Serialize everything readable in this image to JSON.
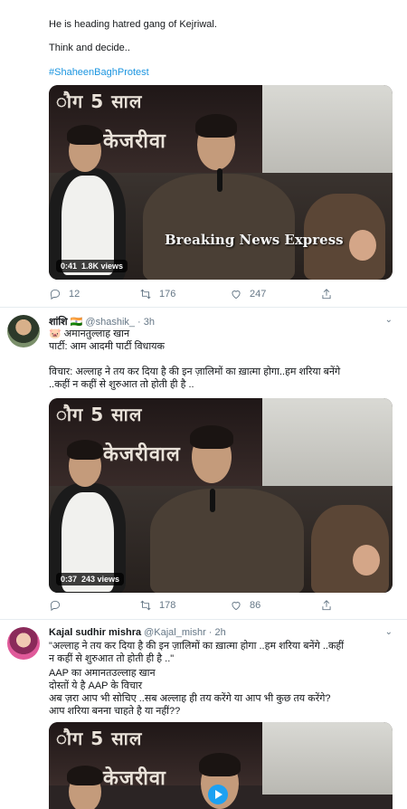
{
  "tweet1": {
    "lines": [
      "He is heading hatred gang of Kejriwal.",
      "Think and decide..",
      "#ShaheenBaghProtest"
    ],
    "video": {
      "banner_line1": "ौग 5 साल",
      "banner_line2": "केजरीवा",
      "watermark": "Breaking News Express",
      "duration": "0:41",
      "views": "1.8K views"
    },
    "actions": {
      "replies": "12",
      "retweets": "176",
      "likes": "247"
    }
  },
  "tweet2": {
    "name": "शांशि 🇮🇳",
    "handle": "@shashik_ · 3h",
    "lines": [
      "🐷 अमानतुल्लाह खान",
      "पार्टी: आम आदमी पार्टी विधायक",
      "",
      "विचार: अल्लाह ने तय कर दिया है की इन ज़ालिमों का ख़ात्मा होगा..हम शरिया बनेंगे",
      "..कहीं न कहीं से शुरुआत तो होती ही है .."
    ],
    "video": {
      "banner_line1": "ौग 5 साल",
      "banner_line2": "केजरीवाल",
      "duration": "0:37",
      "views": "243 views"
    },
    "actions": {
      "retweets": "178",
      "likes": "86"
    }
  },
  "tweet3": {
    "name": "Kajal sudhir mishra",
    "handle": "@Kajal_mishr · 2h",
    "lines": [
      "\"अल्लाह ने तय कर दिया है की इन ज़ालिमों का ख़ात्मा होगा ..हम शरिया बनेंगे ..कहीं",
      "न कहीं से शुरुआत तो होती ही है ..\"",
      "AAP का अमानतउल्लाह खान",
      "दोस्तों ये है AAP के विचार",
      "अब ज़रा आप भी सोचिए ..सब अल्लाह ही तय करेंगे या आप भी कुछ तय करेंगे?",
      "आप शरिया बनना चाहते है या नहीं??"
    ],
    "video": {
      "banner_line1": "ौग 5 साल",
      "banner_line2": "केजरीवा"
    }
  }
}
